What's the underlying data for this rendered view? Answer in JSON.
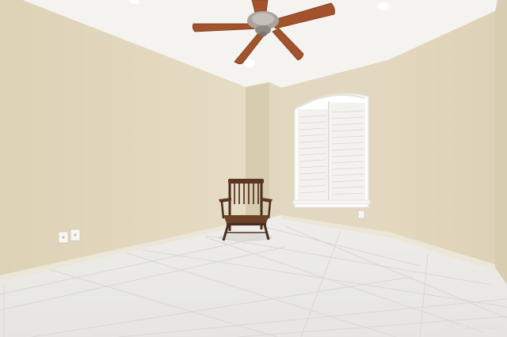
{
  "scene": {
    "type": "photo",
    "colors": {
      "wall": "#e3d9c0",
      "wall_shadow": "#d4c9ad",
      "ceiling": "#f4f3ef",
      "floor": "#e9e8e4",
      "grout": "#d6d4cf",
      "baseboard": "#e7e2d2",
      "fan_blade": "#a3532b",
      "fan_metal": "#9e9a94",
      "chair_wood": "#5a3624",
      "shutter": "#f7f7f5"
    }
  },
  "watermark": {
    "text": "GREATER MCALLEN"
  }
}
